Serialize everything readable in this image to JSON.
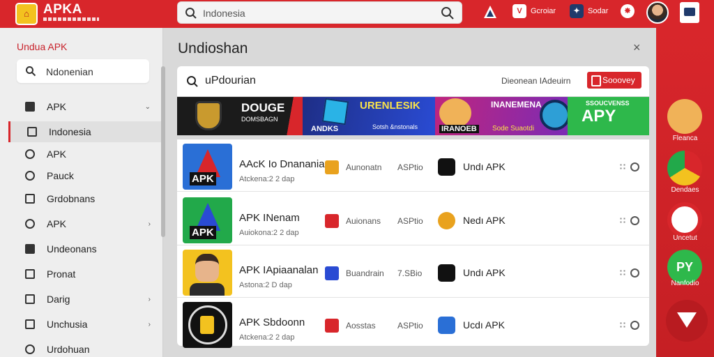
{
  "header": {
    "logo_text": "APKA",
    "search_placeholder": "Indonesia",
    "icons": [
      {
        "name": "brand-a-icon",
        "label": ""
      },
      {
        "name": "v-logo-icon",
        "label": "Gcroiar"
      },
      {
        "name": "shield-app-icon",
        "label": "Sodar"
      },
      {
        "name": "sun-badge-icon",
        "label": ""
      }
    ]
  },
  "sidebar": {
    "title": "Undua APK",
    "search_text": "Ndonenian",
    "items": [
      {
        "label": "APK",
        "icon": "apk-icon",
        "chevron": true
      },
      {
        "label": "Indonesia",
        "icon": "image-icon",
        "chevron": false,
        "active": true
      },
      {
        "label": "APK",
        "icon": "user-icon",
        "chevron": false
      },
      {
        "label": "Pauck",
        "icon": "package-icon",
        "chevron": false
      },
      {
        "label": "Grdobnans",
        "icon": "square-icon",
        "chevron": false
      },
      {
        "label": "APK",
        "icon": "globe-icon",
        "chevron": true
      },
      {
        "label": "Undeonans",
        "icon": "window-icon",
        "chevron": false
      },
      {
        "label": "Pronat",
        "icon": "clipboard-icon",
        "chevron": false
      },
      {
        "label": "Darig",
        "icon": "document-icon",
        "chevron": true
      },
      {
        "label": "Unchusia",
        "icon": "grid-icon",
        "chevron": true
      },
      {
        "label": "Urdohuan",
        "icon": "circle-icon",
        "chevron": false
      }
    ]
  },
  "main": {
    "title": "Undioshan",
    "close_symbol": "×",
    "query": "uPdourian",
    "side_label": "Dieonean IAdeuirn",
    "button_label": "Sooovey",
    "banners": [
      {
        "line1": "DOUGE",
        "line2": "DOMSBAGN"
      },
      {
        "line1": "URENLESIK",
        "line2": "ANDKS",
        "line3": "Sotsh &nstonals"
      },
      {
        "line1": "INANEMENA",
        "line2": "IRANOEB",
        "line3": "Sode Suaotdi"
      },
      {
        "line1": "SSOUCVENSS",
        "line2": "APY"
      }
    ],
    "apps": [
      {
        "title": "AAcK Io Dnananian",
        "sub": "Atckena:2 2 dap",
        "category": "Aunonatn",
        "size": "ASPtio",
        "developer": "Undı APK",
        "icon_colors": [
          "#2a6fd6",
          "#d8262b"
        ],
        "mini_color": "#e9a21e",
        "dev_color": "#111111"
      },
      {
        "title": "APK INenam",
        "sub": "Auiokona:2 2 dap",
        "category": "Auionans",
        "size": "ASPtio",
        "developer": "Nedı APK",
        "icon_colors": [
          "#22a94a",
          "#2a4bd3"
        ],
        "mini_color": "#d8262b",
        "dev_color": "#e9a21e"
      },
      {
        "title": "APK IApiaanalan",
        "sub": "Astona:2 D dap",
        "category": "Buandrain",
        "size": "7.SBio",
        "developer": "Undı APK",
        "icon_colors": [
          "#f3c21f",
          "#e7b48b"
        ],
        "mini_color": "#2a4bd3",
        "dev_color": "#111111"
      },
      {
        "title": "APK Sbdoonn",
        "sub": "Atckena:2 2 dap",
        "category": "Aosstas",
        "size": "ASPtio",
        "developer": "Ucdı APK",
        "icon_colors": [
          "#111111",
          "#f3c21f"
        ],
        "mini_color": "#d8262b",
        "dev_color": "#2a6fd6"
      }
    ]
  },
  "rightbar": {
    "apps": [
      {
        "label": "Fleanca",
        "color": "#f0b258"
      },
      {
        "label": "Dendaes",
        "color": "#2e9fd6"
      },
      {
        "label": "Uncetut",
        "color": "#d8262b"
      },
      {
        "label": "Nanfodio",
        "color": "#2eb84b",
        "text": "PY"
      }
    ]
  },
  "colors": {
    "brand_red": "#d8262b",
    "accent_yellow": "#f3c21f"
  }
}
